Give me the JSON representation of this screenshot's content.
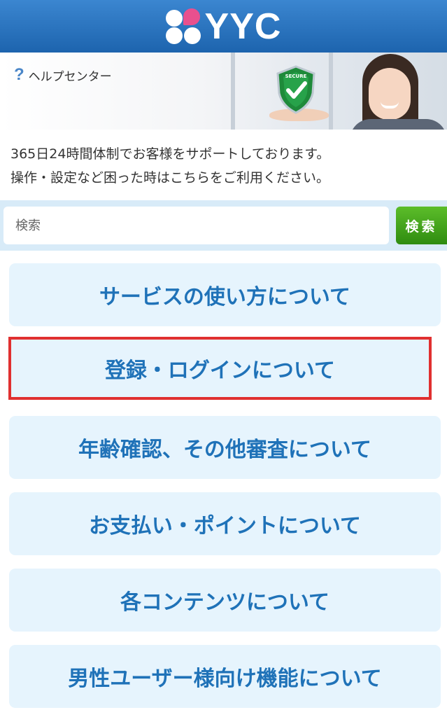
{
  "header": {
    "logo_text": "YYC"
  },
  "hero": {
    "help_icon": "question-mark-icon",
    "help_label": "ヘルプセンター",
    "badge_text": "SECURE"
  },
  "intro": {
    "line1": "365日24時間体制でお客様をサポートしております。",
    "line2": "操作・設定など困った時はこちらをご利用ください。"
  },
  "search": {
    "placeholder": "検索",
    "button_label": "検索"
  },
  "menu": {
    "items": [
      {
        "label": "サービスの使い方について"
      },
      {
        "label": "登録・ログインについて"
      },
      {
        "label": "年齢確認、その他審査について"
      },
      {
        "label": "お支払い・ポイントについて"
      },
      {
        "label": "各コンテンツについて"
      },
      {
        "label": "男性ユーザー様向け機能について"
      }
    ]
  },
  "colors": {
    "header_blue": "#2a74c0",
    "menu_text": "#1f72b8",
    "menu_bg": "#e6f4fd",
    "search_btn_green": "#44a31c",
    "highlight_red": "#e03030"
  }
}
